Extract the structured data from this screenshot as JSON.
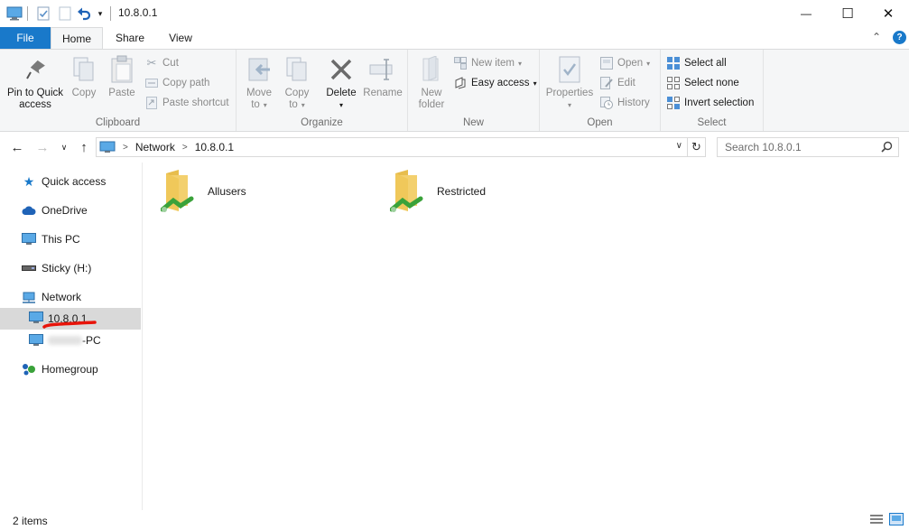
{
  "window": {
    "title": "10.8.0.1",
    "minimize_glyph": "—",
    "maximize_glyph": "☐",
    "close_glyph": "✕"
  },
  "quick_access_toolbar": {
    "icons": [
      "computer-icon",
      "properties-icon",
      "new-folder-icon",
      "undo-icon",
      "customize-dropdown-icon"
    ]
  },
  "tabs": [
    {
      "label": "File"
    },
    {
      "label": "Home"
    },
    {
      "label": "Share"
    },
    {
      "label": "View"
    }
  ],
  "active_tab": "Home",
  "ribbon": {
    "clipboard": {
      "label": "Clipboard",
      "pin_line1": "Pin to Quick",
      "pin_line2": "access",
      "copy": "Copy",
      "paste": "Paste",
      "cut": "Cut",
      "copy_path": "Copy path",
      "paste_shortcut": "Paste shortcut"
    },
    "organize": {
      "label": "Organize",
      "move_line1": "Move",
      "move_line2": "to",
      "copy_line1": "Copy",
      "copy_line2": "to",
      "delete": "Delete",
      "rename": "Rename"
    },
    "new": {
      "label": "New",
      "new_folder_line1": "New",
      "new_folder_line2": "folder",
      "new_item": "New item",
      "easy_access": "Easy access"
    },
    "open": {
      "label": "Open",
      "properties": "Properties",
      "open": "Open",
      "edit": "Edit",
      "history": "History"
    },
    "select": {
      "label": "Select",
      "select_all": "Select all",
      "select_none": "Select none",
      "invert_selection": "Invert selection"
    }
  },
  "address_bar": {
    "crumbs": [
      "Network",
      "10.8.0.1"
    ],
    "separator": ">"
  },
  "search": {
    "placeholder": "Search 10.8.0.1"
  },
  "nav_pane": {
    "quick_access": "Quick access",
    "onedrive": "OneDrive",
    "this_pc": "This PC",
    "sticky": "Sticky (H:)",
    "network": "Network",
    "host_selected": "10.8.0.1",
    "host_other_suffix": "-PC",
    "homegroup": "Homegroup"
  },
  "content": {
    "items": [
      {
        "name": "Allusers"
      },
      {
        "name": "Restricted"
      }
    ]
  },
  "status": {
    "item_count": "2 items"
  },
  "colors": {
    "accent": "#1979ca",
    "selected_bg": "#d9d9d9",
    "annotation_red": "#e8140a",
    "folder_yellow": "#f3d06e",
    "share_green": "#3aa23a"
  }
}
